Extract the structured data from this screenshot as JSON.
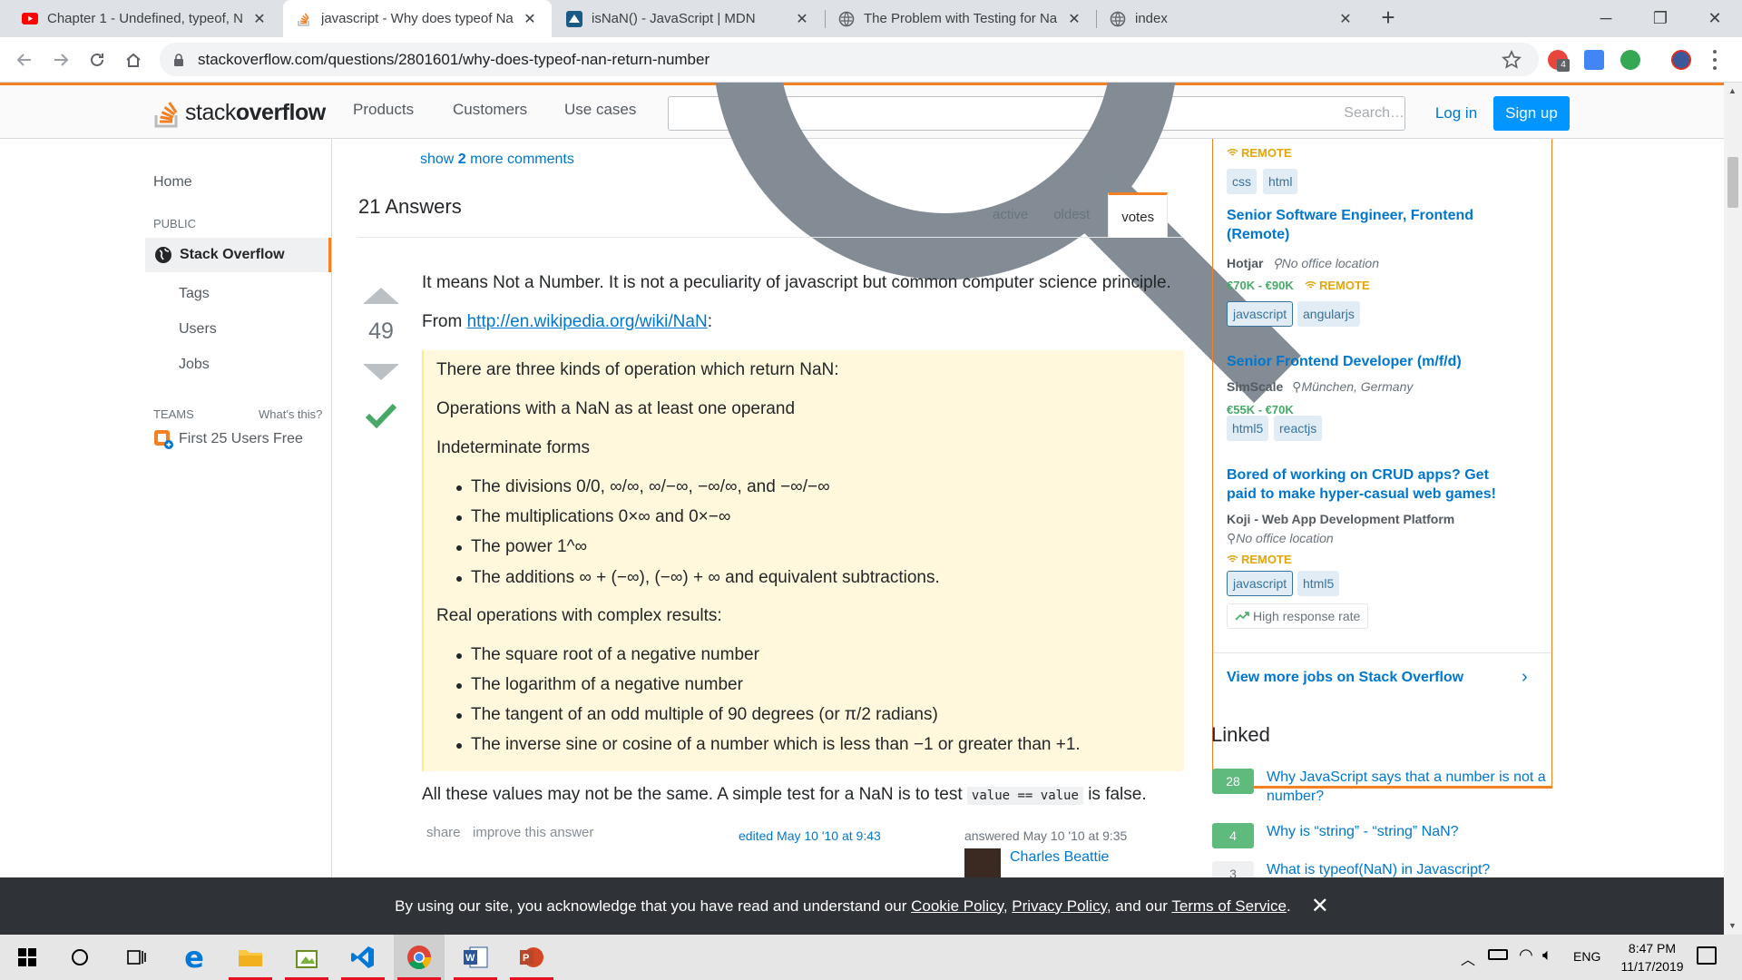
{
  "browser": {
    "tabs": [
      {
        "title": "Chapter 1 - Undefined, typeof, N",
        "icon": "youtube-icon"
      },
      {
        "title": "javascript - Why does typeof Na",
        "icon": "stackoverflow-icon",
        "active": true
      },
      {
        "title": "isNaN() - JavaScript | MDN",
        "icon": "mdn-icon"
      },
      {
        "title": "The Problem with Testing for Na",
        "icon": "globe-icon"
      },
      {
        "title": "index",
        "icon": "globe-icon"
      }
    ],
    "url": "stackoverflow.com/questions/2801601/why-does-typeof-nan-return-number",
    "ext_badge": "4"
  },
  "so": {
    "logo_light": "stack",
    "logo_bold": "overflow",
    "nav": [
      "Products",
      "Customers",
      "Use cases"
    ],
    "search_placeholder": "Search…",
    "login": "Log in",
    "signup": "Sign up"
  },
  "leftbar": {
    "home": "Home",
    "public_caption": "PUBLIC",
    "stack_overflow": "Stack Overflow",
    "tags": "Tags",
    "users": "Users",
    "jobs": "Jobs",
    "teams_caption": "TEAMS",
    "whats_this": "What's this?",
    "teams_free": "First 25 Users Free"
  },
  "question": {
    "show_more_pre": "show ",
    "show_more_count": "2",
    "show_more_post": " more comments",
    "answers_title": "21 Answers",
    "sort_tabs": [
      "active",
      "oldest",
      "votes"
    ]
  },
  "answer": {
    "votes": "49",
    "p1": "It means Not a Number. It is not a peculiarity of javascript but common computer science principle.",
    "from_label": "From ",
    "from_link": "http://en.wikipedia.org/wiki/NaN",
    "from_colon": ":",
    "quote": {
      "intro": "There are three kinds of operation which return NaN:",
      "op1": "Operations with a NaN as at least one operand",
      "indeterminate": "Indeterminate forms",
      "indet_items": [
        "The divisions 0/0, ∞/∞, ∞/−∞, −∞/∞, and −∞/−∞",
        "The multiplications 0×∞ and 0×−∞",
        "The power 1^∞",
        "The additions ∞ + (−∞), (−∞) + ∞ and equivalent subtractions."
      ],
      "real_ops": "Real operations with complex results:",
      "real_items": [
        "The square root of a negative number",
        "The logarithm of a negative number",
        "The tangent of an odd multiple of 90 degrees (or π/2 radians)",
        "The inverse sine or cosine of a number which is less than −1 or greater than +1."
      ]
    },
    "last_pre": "All these values may not be the same. A simple test for a NaN is to test ",
    "last_code": "value == value",
    "last_post": " is false.",
    "share": "share",
    "improve": "improve this answer",
    "edited": "edited May 10 '10 at 9:43",
    "answered": "answered May 10 '10 at 9:35",
    "author": "Charles Beattie"
  },
  "jobs": {
    "top_remote": "REMOTE",
    "top_tags": [
      "css",
      "html"
    ],
    "listings": [
      {
        "title": "Senior Software Engineer, Frontend (Remote)",
        "company": "Hotjar",
        "location": "No office location",
        "salary": "€70K - €90K",
        "remote": "REMOTE",
        "tags": [
          "javascript",
          "angularjs"
        ]
      },
      {
        "title": "Senior Frontend Developer (m/f/d)",
        "company": "SimScale",
        "location": "München, Germany",
        "salary": "€55K - €70K",
        "tags": [
          "html5",
          "reactjs"
        ]
      },
      {
        "title": "Bored of working on CRUD apps? Get paid to make hyper-casual web games!",
        "company": "Koji - Web App Development Platform",
        "location": "No office location",
        "remote": "REMOTE",
        "tags": [
          "javascript",
          "html5"
        ],
        "badge": "High response rate"
      }
    ],
    "view_more": "View more jobs on Stack Overflow"
  },
  "linked": {
    "title": "Linked",
    "items": [
      {
        "score": "28",
        "text": "Why JavaScript says that a number is not a number?"
      },
      {
        "score": "4",
        "text": "Why is “string” - “string” NaN?"
      },
      {
        "score": "3",
        "text": "What is typeof(NaN) in Javascript?"
      }
    ]
  },
  "cookie": {
    "pre": "By using our site, you acknowledge that you have read and understand our ",
    "cookie_policy": "Cookie Policy",
    "sep1": ", ",
    "privacy_policy": "Privacy Policy",
    "sep2": ", and our ",
    "terms": "Terms of Service",
    "post": "."
  },
  "taskbar": {
    "lang": "ENG",
    "time": "8:47 PM",
    "date": "11/17/2019"
  },
  "colors": {
    "so_orange": "#f48024",
    "so_blue": "#0077cc",
    "accept_green": "#48a868",
    "quote_bg": "#fff8dc"
  }
}
